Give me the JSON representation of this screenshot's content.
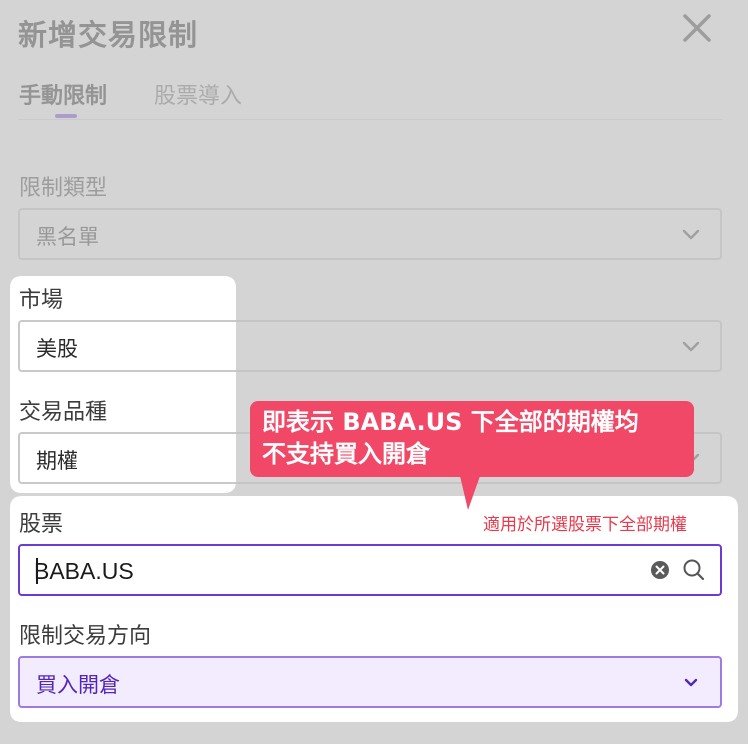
{
  "dialog": {
    "title": "新增交易限制",
    "close_icon": "close-icon"
  },
  "tabs": [
    {
      "label": "手動限制",
      "active": true
    },
    {
      "label": "股票導入",
      "active": false
    }
  ],
  "form": {
    "restriction_type": {
      "label": "限制類型",
      "value": "黑名單"
    },
    "market": {
      "label": "市場",
      "value": "美股"
    },
    "product_type": {
      "label": "交易品種",
      "value": "期權"
    },
    "stock": {
      "label": "股票",
      "value": "BABA.US",
      "clear_icon": "clear-icon",
      "search_icon": "search-icon"
    },
    "direction": {
      "label": "限制交易方向",
      "value": "買入開倉"
    }
  },
  "annotation": {
    "callout_line1": "即表示 BABA.US 下全部的期權均",
    "callout_line2": "不支持買入開倉",
    "note": "適用於所選股票下全部期權"
  },
  "colors": {
    "accent": "#6e3ad6",
    "callout": "#f04866",
    "note": "#e83a4c",
    "overlay_dim": "#c4c4c4"
  }
}
